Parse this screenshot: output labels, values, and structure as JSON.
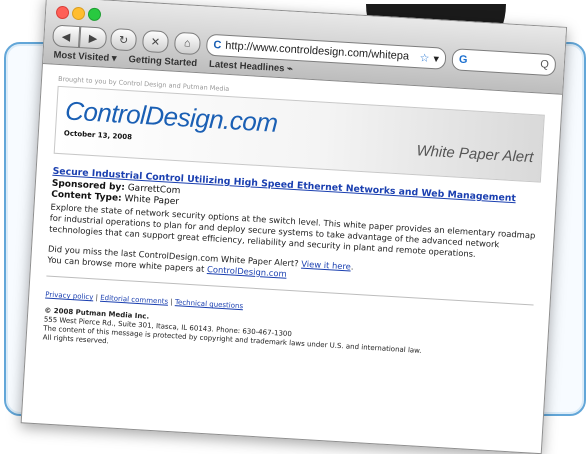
{
  "toolbar": {
    "url": "http://www.controldesign.com/whitepa",
    "search_placeholder": "Q"
  },
  "bookmarks": [
    {
      "label": "Most Visited ▾"
    },
    {
      "label": "Getting Started"
    },
    {
      "label": "Latest Headlines ⌁"
    }
  ],
  "email": {
    "brought_by": "Brought to you by Control Design and Putman Media",
    "logo": "ControlDesign.com",
    "date": "October 13, 2008",
    "alert_label": "White Paper Alert",
    "article_title": "Secure Industrial Control Utilizing High Speed Ethernet Networks and Web Management",
    "sponsored_label": "Sponsored by:",
    "sponsor": "GarrettCom",
    "content_type_label": "Content Type:",
    "content_type": "White Paper",
    "description": "Explore the state of network security options at the switch level. This white paper provides an elementary roadmap for industrial operations to plan for and deploy secure systems to take advantage of the advanced network technologies that can support great efficiency, reliability and security in plant and remote operations.",
    "missed_prefix": "Did you miss the last ControlDesign.com White Paper Alert?",
    "view_it_here": "View it here",
    "browse_prefix": "You can browse more white papers at",
    "browse_link": "ControlDesign.com",
    "footer_links": [
      "Privacy policy",
      "Editorial comments",
      "Technical questions"
    ],
    "copyright_company": "© 2008 Putman Media Inc.",
    "address": "555 West Pierce Rd., Suite 301, Itasca, IL 60143. Phone: 630-467-1300",
    "legal": "The content of this message is protected by copyright and trademark laws under U.S. and international law.",
    "rights": "All rights reserved."
  }
}
